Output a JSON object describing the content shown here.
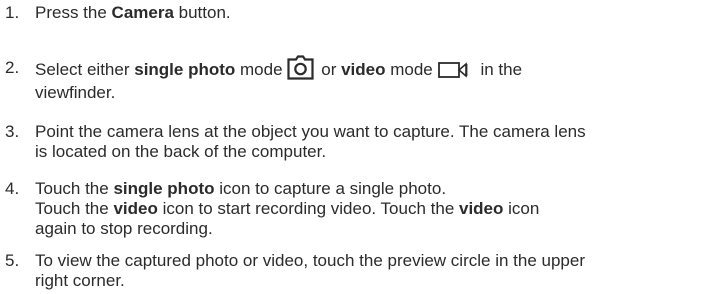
{
  "steps": [
    {
      "number": "1.",
      "lines": [
        {
          "before": "Press the ",
          "bold": "Camera",
          "after": " button."
        }
      ]
    },
    {
      "number": "2.",
      "line1": {
        "t1": "Select either ",
        "b1": "single photo",
        "t2": " mode",
        "t3": " or ",
        "b2": "video",
        "t4": " mode",
        "t5": " in the"
      },
      "line2": "viewfinder.",
      "icons": [
        "camera-icon",
        "video-camera-icon"
      ]
    },
    {
      "number": "3.",
      "line1": "Point the camera lens at the object you want to capture. The camera lens",
      "line2": "is located on the back of the computer."
    },
    {
      "number": "4.",
      "line1": {
        "t1": "Touch the ",
        "b1": "single photo",
        "t2": " icon to capture a single photo."
      },
      "line2": {
        "t1": "Touch the ",
        "b1": "video",
        "t2": " icon to start recording video. Touch the ",
        "b2": "video",
        "t3": " icon"
      },
      "line3": "again to stop recording."
    },
    {
      "number": "5.",
      "line1": "To view the captured photo or video, touch the preview circle in the upper",
      "line2": "right corner."
    }
  ]
}
